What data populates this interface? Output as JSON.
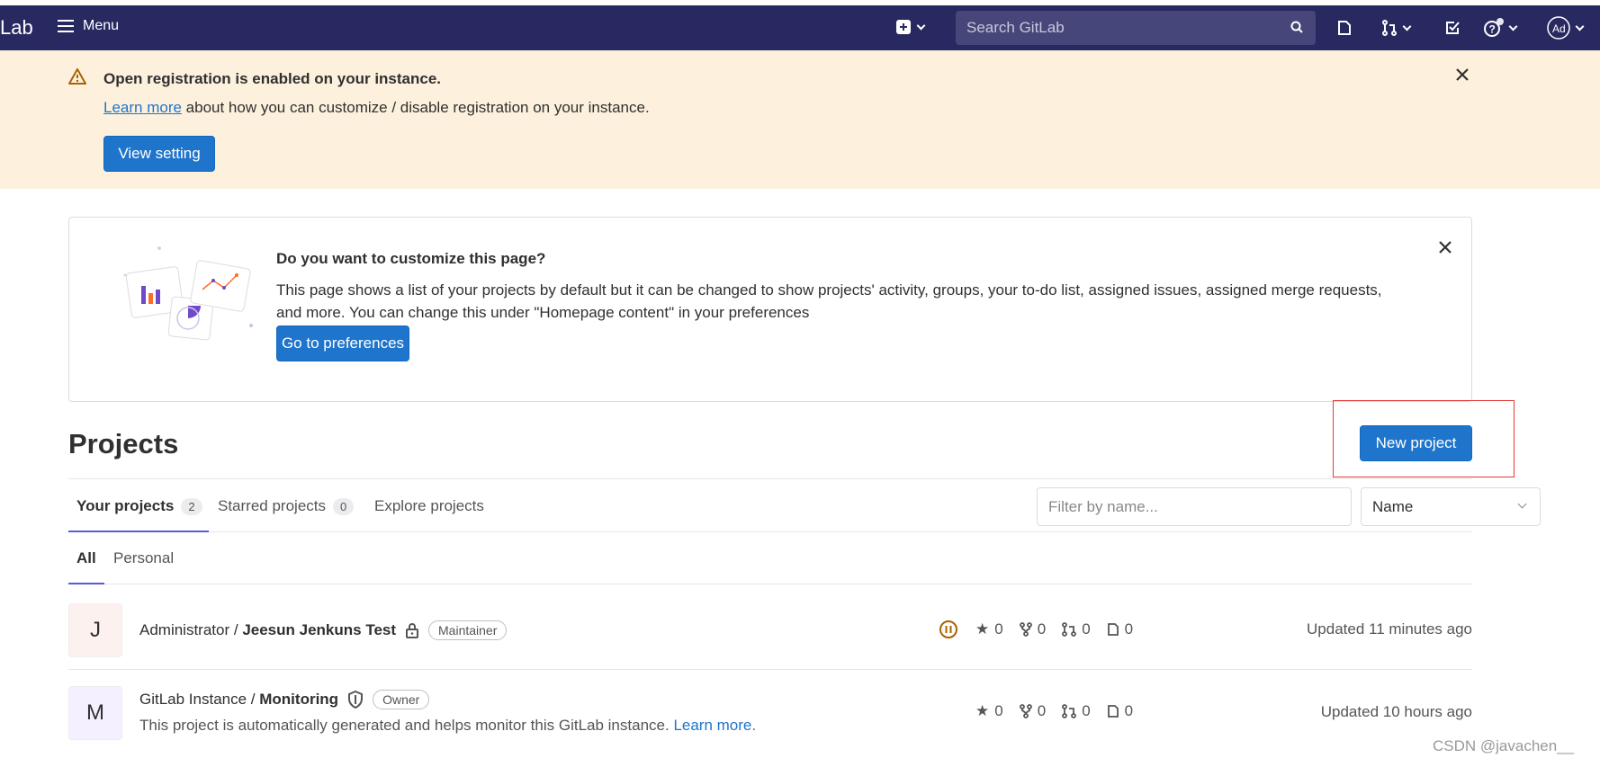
{
  "nav": {
    "brand": "Lab",
    "menu_label": "Menu",
    "search_placeholder": "Search GitLab",
    "avatar_initials": "Ad"
  },
  "alert": {
    "title": "Open registration is enabled on your instance.",
    "link_text": "Learn more",
    "text_rest": " about how you can customize / disable registration on your instance.",
    "button_label": "View setting"
  },
  "customize": {
    "title": "Do you want to customize this page?",
    "body": "This page shows a list of your projects by default but it can be changed to show projects' activity, groups, your to-do list, assigned issues, assigned merge requests, and more. You can change this under \"Homepage content\" in your preferences",
    "button_label": "Go to preferences"
  },
  "projects": {
    "title": "Projects",
    "new_project_label": "New project",
    "tabs": [
      {
        "label": "Your projects",
        "count": "2"
      },
      {
        "label": "Starred projects",
        "count": "0"
      },
      {
        "label": "Explore projects"
      }
    ],
    "filter_placeholder": "Filter by name...",
    "sort_value": "Name",
    "subtabs": [
      "All",
      "Personal"
    ],
    "rows": [
      {
        "initial": "J",
        "namespace": "Administrator / ",
        "name": "Jeesun Jenkuns Test",
        "role": "Maintainer",
        "stars": "0",
        "forks": "0",
        "merge_requests": "0",
        "issues": "0",
        "updated": "Updated 11 minutes ago"
      },
      {
        "initial": "M",
        "namespace": "GitLab Instance / ",
        "name": "Monitoring",
        "role": "Owner",
        "description": "This project is automatically generated and helps monitor this GitLab instance.",
        "description_link": "Learn more.",
        "stars": "0",
        "forks": "0",
        "merge_requests": "0",
        "issues": "0",
        "updated": "Updated 10 hours ago"
      }
    ]
  },
  "watermark": "CSDN @javachen__",
  "colors": {
    "nav_bg": "#292961",
    "alert_bg": "#fdf1dd",
    "primary": "#1f75cb",
    "tab_underline": "#5b5bd6",
    "highlight": "#e53935"
  }
}
